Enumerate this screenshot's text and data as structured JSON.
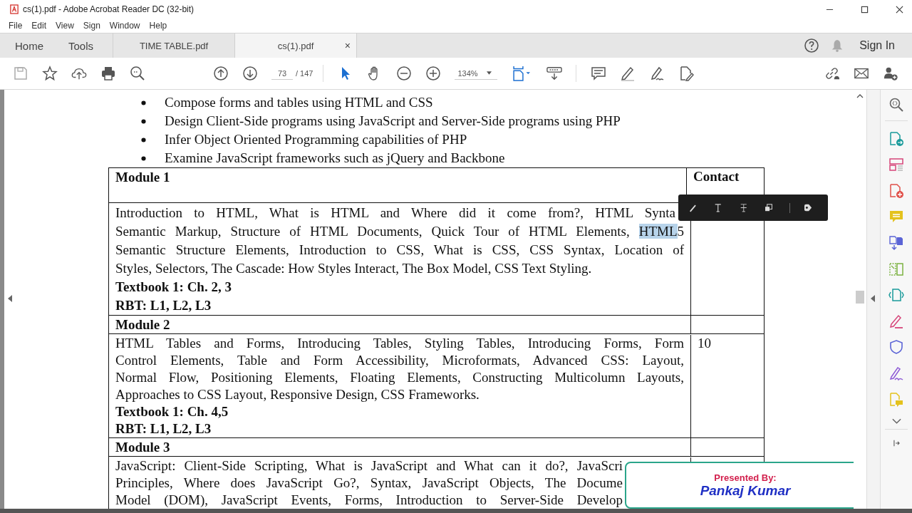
{
  "window": {
    "title": "cs(1).pdf - Adobe Acrobat Reader DC (32-bit)"
  },
  "menu": [
    "File",
    "Edit",
    "View",
    "Sign",
    "Window",
    "Help"
  ],
  "tabs": [
    {
      "label": "Home",
      "kind": "nav",
      "selected": false
    },
    {
      "label": "Tools",
      "kind": "nav",
      "selected": false
    },
    {
      "label": "TIME TABLE.pdf",
      "kind": "document",
      "selected": false
    },
    {
      "label": "cs(1).pdf",
      "kind": "document",
      "selected": true,
      "close": "×"
    }
  ],
  "sign_in": "Sign In",
  "toolbar": {
    "page": "73",
    "page_count": "/ 147",
    "zoom": "134%"
  },
  "bullets": [
    "Compose forms and tables using HTML and CSS",
    "Design Client-Side programs using JavaScript and Server-Side programs using PHP",
    "Infer Object Oriented Programming capabilities of PHP",
    "Examine JavaScript frameworks such as jQuery and Backbone"
  ],
  "table": {
    "rows": [
      {
        "kind": "header",
        "module": "Module 1",
        "hours": "Contact"
      },
      {
        "kind": "content",
        "lines": [
          [
            {
              "text": "Introduction to HTML, What is HTML and Where did it come from?, HTML Synta",
              "selected": false,
              "cut": true
            }
          ],
          [
            {
              "text": "Semantic Markup, Structure of HTML Documents, Quick Tour of HTML Elements, ",
              "selected": false
            },
            {
              "text": "HTML",
              "selected": true
            },
            {
              "text": "5",
              "selected": false
            }
          ],
          [
            {
              "text": "Semantic Structure Elements, Introduction to CSS, What is CSS, CSS Syntax, Location of",
              "selected": false
            }
          ],
          [
            {
              "text": "Styles, Selectors, The Cascade: How Styles Interact, The Box Model, CSS Text Styling.",
              "selected": false
            }
          ]
        ],
        "textbook": "Textbook 1: Ch. 2, 3",
        "rbt": "RBT: L1, L2, L3"
      },
      {
        "kind": "header",
        "module": "Module 2"
      },
      {
        "kind": "content",
        "lines": [
          [
            {
              "text": "HTML Tables and Forms, Introducing Tables, Styling Tables, Introducing Forms, Form",
              "selected": false
            }
          ],
          [
            {
              "text": "Control Elements, Table and Form Accessibility, Microformats, Advanced CSS: Layout,",
              "selected": false
            }
          ],
          [
            {
              "text": "Normal Flow, Positioning Elements, Floating Elements, Constructing Multicolumn Layouts,",
              "selected": false
            }
          ],
          [
            {
              "text": "Approaches to CSS Layout, Responsive Design, CSS Frameworks.",
              "selected": false
            }
          ]
        ],
        "textbook": "Textbook 1: Ch. 4,5",
        "rbt": "RBT: L1, L2, L3",
        "hours": "10"
      },
      {
        "kind": "header",
        "module": "Module 3"
      },
      {
        "kind": "cut",
        "lines": [
          [
            {
              "text": "JavaScript: Client-Side Scripting, What is JavaScript and What can it do?, JavaScri",
              "selected": false
            }
          ],
          [
            {
              "text": "Principles, Where does JavaScript Go?, Syntax, JavaScript Objects, The Docume",
              "selected": false
            }
          ],
          [
            {
              "text": "Model (DOM), JavaScript Events, Forms, Introduction to Server-Side Develop",
              "selected": false
            }
          ]
        ]
      }
    ]
  },
  "overlay": {
    "label": "Presented By:",
    "name": "Pankaj Kumar"
  }
}
